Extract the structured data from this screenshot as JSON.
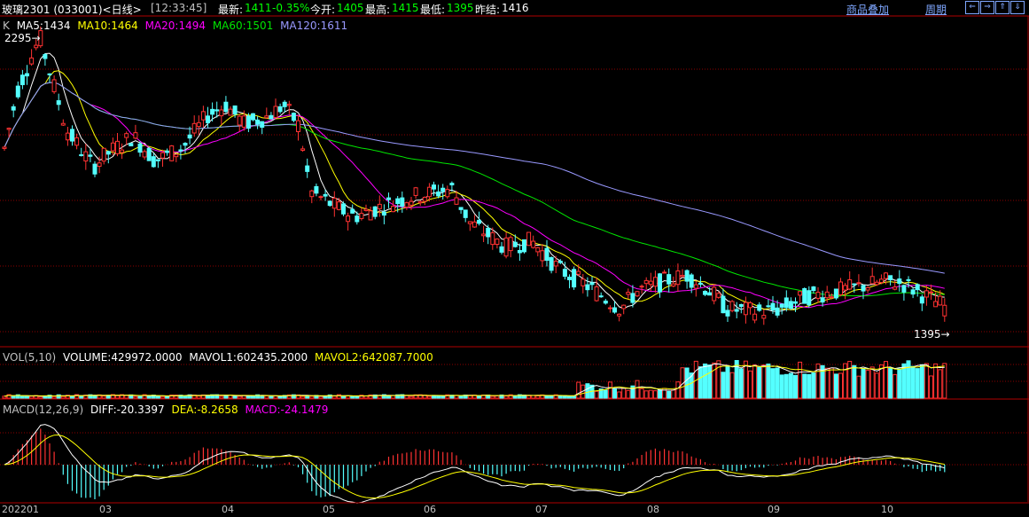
{
  "header": {
    "contract": "玻璃2301 (033001)<日线>",
    "time": "[12:33:45]",
    "latest_label": "最新:",
    "latest_value": "1411",
    "change": "-0.35%",
    "open_label": "今开:",
    "open_value": "1405",
    "high_label": "最高:",
    "high_value": "1415",
    "low_label": "最低:",
    "low_value": "1395",
    "prev_close_label": "昨结:",
    "prev_close_value": "1416",
    "overlay_link": "商品叠加",
    "period_link": "周期",
    "nav_buttons": [
      "⇐",
      "⇒",
      "⇑",
      "⇓"
    ]
  },
  "main_legend": {
    "k": "K",
    "ma5": "MA5:1434",
    "ma10": "MA10:1464",
    "ma20": "MA20:1494",
    "ma60": "MA60:1501",
    "ma120": "MA120:1611"
  },
  "price_marks": {
    "high": "2295",
    "low": "1395"
  },
  "vol_legend": {
    "label": "VOL(5,10)",
    "volume": "VOLUME:429972.0000",
    "mavol1": "MAVOL1:602435.2000",
    "mavol2": "MAVOL2:642087.7000"
  },
  "macd_legend": {
    "label": "MACD(12,26,9)",
    "diff": "DIFF:-20.3397",
    "dea": "DEA:-8.2658",
    "macd": "MACD:-24.1479"
  },
  "x_axis": {
    "labels": [
      "202201",
      "03",
      "04",
      "05",
      "06",
      "07",
      "08",
      "09",
      "10"
    ]
  },
  "colors": {
    "up": "#ff3232",
    "down": "#54ffff",
    "ma5": "#ffffff",
    "ma10": "#ffff00",
    "ma20": "#ff00ff",
    "ma60": "#00e600",
    "ma120": "#9999ff",
    "grid": "#8b0000",
    "latest": "#00ff00",
    "link": "#7fa7ff"
  }
}
